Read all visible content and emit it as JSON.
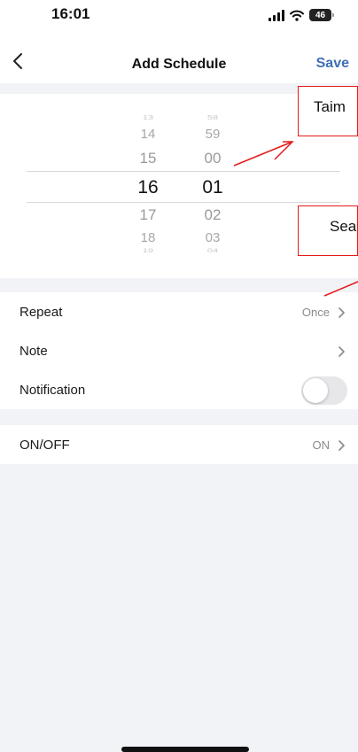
{
  "status_bar": {
    "time": "16:01",
    "battery": "46"
  },
  "nav": {
    "title": "Add Schedule",
    "save_label": "Save"
  },
  "picker": {
    "hours": [
      "13",
      "14",
      "15",
      "16",
      "17",
      "18",
      "19"
    ],
    "minutes": [
      "58",
      "59",
      "00",
      "01",
      "02",
      "03",
      "04"
    ],
    "selected_hour": "16",
    "selected_minute": "01"
  },
  "settings": {
    "repeat": {
      "label": "Repeat",
      "value": "Once"
    },
    "note": {
      "label": "Note"
    },
    "notification": {
      "label": "Notification",
      "enabled": false
    },
    "onoff": {
      "label": "ON/OFF",
      "value": "ON"
    }
  },
  "annotations": {
    "callout_1": "Taim",
    "callout_2": "Sea"
  },
  "colors": {
    "accent": "#3f6fb5",
    "annotation": "#e31b1b",
    "background": "#f2f3f7"
  },
  "icons": [
    "signal-icon",
    "wifi-icon",
    "battery-icon",
    "back-icon",
    "chevron-right-icon",
    "toggle-switch"
  ]
}
